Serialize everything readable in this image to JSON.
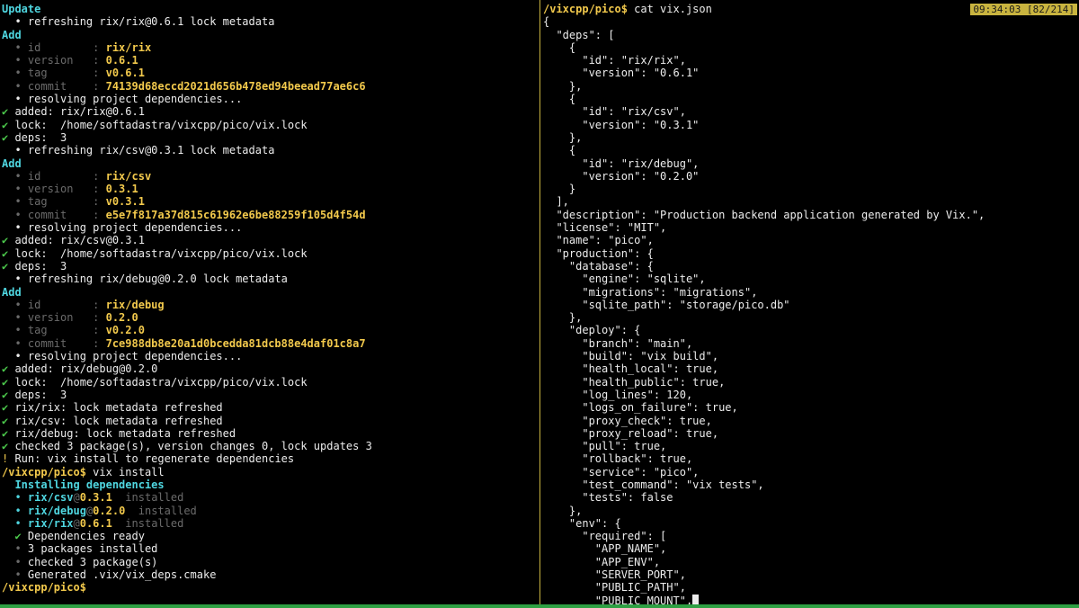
{
  "left": {
    "lines": [
      {
        "segs": [
          {
            "t": "Update",
            "c": "cyan bold"
          }
        ]
      },
      {
        "segs": [
          {
            "t": "  • refreshing rix/rix@0.6.1 lock metadata",
            "c": "white"
          }
        ]
      },
      {
        "segs": [
          {
            "t": "Add",
            "c": "cyan bold"
          }
        ]
      },
      {
        "segs": [
          {
            "t": "  • id        : ",
            "c": "dim"
          },
          {
            "t": "rix/rix",
            "c": "yellow bold"
          }
        ]
      },
      {
        "segs": [
          {
            "t": "  • version   : ",
            "c": "dim"
          },
          {
            "t": "0.6.1",
            "c": "yellow bold"
          }
        ]
      },
      {
        "segs": [
          {
            "t": "  • tag       : ",
            "c": "dim"
          },
          {
            "t": "v0.6.1",
            "c": "yellow bold"
          }
        ]
      },
      {
        "segs": [
          {
            "t": "  • commit    : ",
            "c": "dim"
          },
          {
            "t": "74139d68eccd2021d656b478ed94beead77ae6c6",
            "c": "yellow bold"
          }
        ]
      },
      {
        "segs": [
          {
            "t": "  • resolving project dependencies...",
            "c": "white"
          }
        ]
      },
      {
        "segs": [
          {
            "t": "✔",
            "c": "green"
          },
          {
            "t": " added: rix/rix@0.6.1",
            "c": "white"
          }
        ]
      },
      {
        "segs": [
          {
            "t": "✔",
            "c": "green"
          },
          {
            "t": " lock:  /home/softadastra/vixcpp/pico/vix.lock",
            "c": "white"
          }
        ]
      },
      {
        "segs": [
          {
            "t": "✔",
            "c": "green"
          },
          {
            "t": " deps:  3",
            "c": "white"
          }
        ]
      },
      {
        "segs": [
          {
            "t": "  • refreshing rix/csv@0.3.1 lock metadata",
            "c": "white"
          }
        ]
      },
      {
        "segs": [
          {
            "t": "Add",
            "c": "cyan bold"
          }
        ]
      },
      {
        "segs": [
          {
            "t": "  • id        : ",
            "c": "dim"
          },
          {
            "t": "rix/csv",
            "c": "yellow bold"
          }
        ]
      },
      {
        "segs": [
          {
            "t": "  • version   : ",
            "c": "dim"
          },
          {
            "t": "0.3.1",
            "c": "yellow bold"
          }
        ]
      },
      {
        "segs": [
          {
            "t": "  • tag       : ",
            "c": "dim"
          },
          {
            "t": "v0.3.1",
            "c": "yellow bold"
          }
        ]
      },
      {
        "segs": [
          {
            "t": "  • commit    : ",
            "c": "dim"
          },
          {
            "t": "e5e7f817a37d815c61962e6be88259f105d4f54d",
            "c": "yellow bold"
          }
        ]
      },
      {
        "segs": [
          {
            "t": "  • resolving project dependencies...",
            "c": "white"
          }
        ]
      },
      {
        "segs": [
          {
            "t": "✔",
            "c": "green"
          },
          {
            "t": " added: rix/csv@0.3.1",
            "c": "white"
          }
        ]
      },
      {
        "segs": [
          {
            "t": "✔",
            "c": "green"
          },
          {
            "t": " lock:  /home/softadastra/vixcpp/pico/vix.lock",
            "c": "white"
          }
        ]
      },
      {
        "segs": [
          {
            "t": "✔",
            "c": "green"
          },
          {
            "t": " deps:  3",
            "c": "white"
          }
        ]
      },
      {
        "segs": [
          {
            "t": "  • refreshing rix/debug@0.2.0 lock metadata",
            "c": "white"
          }
        ]
      },
      {
        "segs": [
          {
            "t": "Add",
            "c": "cyan bold"
          }
        ]
      },
      {
        "segs": [
          {
            "t": "  • id        : ",
            "c": "dim"
          },
          {
            "t": "rix/debug",
            "c": "yellow bold"
          }
        ]
      },
      {
        "segs": [
          {
            "t": "  • version   : ",
            "c": "dim"
          },
          {
            "t": "0.2.0",
            "c": "yellow bold"
          }
        ]
      },
      {
        "segs": [
          {
            "t": "  • tag       : ",
            "c": "dim"
          },
          {
            "t": "v0.2.0",
            "c": "yellow bold"
          }
        ]
      },
      {
        "segs": [
          {
            "t": "  • commit    : ",
            "c": "dim"
          },
          {
            "t": "7ce988db8e20a1d0bcedda81dcb88e4daf01c8a7",
            "c": "yellow bold"
          }
        ]
      },
      {
        "segs": [
          {
            "t": "  • resolving project dependencies...",
            "c": "white"
          }
        ]
      },
      {
        "segs": [
          {
            "t": "✔",
            "c": "green"
          },
          {
            "t": " added: rix/debug@0.2.0",
            "c": "white"
          }
        ]
      },
      {
        "segs": [
          {
            "t": "✔",
            "c": "green"
          },
          {
            "t": " lock:  /home/softadastra/vixcpp/pico/vix.lock",
            "c": "white"
          }
        ]
      },
      {
        "segs": [
          {
            "t": "✔",
            "c": "green"
          },
          {
            "t": " deps:  3",
            "c": "white"
          }
        ]
      },
      {
        "segs": [
          {
            "t": "✔",
            "c": "green"
          },
          {
            "t": " rix/rix: lock metadata refreshed",
            "c": "white"
          }
        ]
      },
      {
        "segs": [
          {
            "t": "✔",
            "c": "green"
          },
          {
            "t": " rix/csv: lock metadata refreshed",
            "c": "white"
          }
        ]
      },
      {
        "segs": [
          {
            "t": "✔",
            "c": "green"
          },
          {
            "t": " rix/debug: lock metadata refreshed",
            "c": "white"
          }
        ]
      },
      {
        "segs": [
          {
            "t": "✔",
            "c": "green"
          },
          {
            "t": " checked 3 package(s), version changes 0, lock updates 3",
            "c": "white"
          }
        ]
      },
      {
        "segs": [
          {
            "t": "!",
            "c": "yellow"
          },
          {
            "t": " Run: vix install to regenerate dependencies",
            "c": "white"
          }
        ]
      },
      {
        "segs": [
          {
            "t": "/vixcpp/pico$",
            "c": "prompt-path"
          },
          {
            "t": " vix install",
            "c": "white"
          }
        ]
      },
      {
        "segs": [
          {
            "t": "  Installing dependencies",
            "c": "cyan bold"
          }
        ]
      },
      {
        "segs": [
          {
            "t": "  • ",
            "c": "cyan"
          },
          {
            "t": "rix/csv",
            "c": "cyan bold"
          },
          {
            "t": "@",
            "c": "dim"
          },
          {
            "t": "0.3.1",
            "c": "yellow bold"
          },
          {
            "t": "  installed",
            "c": "dim"
          }
        ]
      },
      {
        "segs": [
          {
            "t": "  • ",
            "c": "cyan"
          },
          {
            "t": "rix/debug",
            "c": "cyan bold"
          },
          {
            "t": "@",
            "c": "dim"
          },
          {
            "t": "0.2.0",
            "c": "yellow bold"
          },
          {
            "t": "  installed",
            "c": "dim"
          }
        ]
      },
      {
        "segs": [
          {
            "t": "  • ",
            "c": "cyan"
          },
          {
            "t": "rix/rix",
            "c": "cyan bold"
          },
          {
            "t": "@",
            "c": "dim"
          },
          {
            "t": "0.6.1",
            "c": "yellow bold"
          },
          {
            "t": "  installed",
            "c": "dim"
          }
        ]
      },
      {
        "segs": [
          {
            "t": "  ✔",
            "c": "green"
          },
          {
            "t": " Dependencies ready",
            "c": "white"
          }
        ]
      },
      {
        "segs": [
          {
            "t": "  •",
            "c": "dim"
          },
          {
            "t": " 3 packages installed",
            "c": "white"
          }
        ]
      },
      {
        "segs": [
          {
            "t": "  •",
            "c": "dim"
          },
          {
            "t": " checked 3 package(s)",
            "c": "white"
          }
        ]
      },
      {
        "segs": [
          {
            "t": "  •",
            "c": "dim"
          },
          {
            "t": " Generated .vix/vix_deps.cmake",
            "c": "white"
          }
        ]
      },
      {
        "segs": [
          {
            "t": "/vixcpp/pico$",
            "c": "prompt-path"
          }
        ]
      }
    ]
  },
  "right": {
    "clock": "09:34:03 [82/214]",
    "lines": [
      {
        "segs": [
          {
            "t": "/vixcpp/pico$",
            "c": "prompt-path"
          },
          {
            "t": " cat vix.json",
            "c": "white"
          }
        ]
      },
      {
        "segs": [
          {
            "t": "{",
            "c": "white"
          }
        ]
      },
      {
        "segs": [
          {
            "t": "  \"deps\": [",
            "c": "white"
          }
        ]
      },
      {
        "segs": [
          {
            "t": "    {",
            "c": "white"
          }
        ]
      },
      {
        "segs": [
          {
            "t": "      \"id\": \"rix/rix\",",
            "c": "white"
          }
        ]
      },
      {
        "segs": [
          {
            "t": "      \"version\": \"0.6.1\"",
            "c": "white"
          }
        ]
      },
      {
        "segs": [
          {
            "t": "    },",
            "c": "white"
          }
        ]
      },
      {
        "segs": [
          {
            "t": "    {",
            "c": "white"
          }
        ]
      },
      {
        "segs": [
          {
            "t": "      \"id\": \"rix/csv\",",
            "c": "white"
          }
        ]
      },
      {
        "segs": [
          {
            "t": "      \"version\": \"0.3.1\"",
            "c": "white"
          }
        ]
      },
      {
        "segs": [
          {
            "t": "    },",
            "c": "white"
          }
        ]
      },
      {
        "segs": [
          {
            "t": "    {",
            "c": "white"
          }
        ]
      },
      {
        "segs": [
          {
            "t": "      \"id\": \"rix/debug\",",
            "c": "white"
          }
        ]
      },
      {
        "segs": [
          {
            "t": "      \"version\": \"0.2.0\"",
            "c": "white"
          }
        ]
      },
      {
        "segs": [
          {
            "t": "    }",
            "c": "white"
          }
        ]
      },
      {
        "segs": [
          {
            "t": "  ],",
            "c": "white"
          }
        ]
      },
      {
        "segs": [
          {
            "t": "  \"description\": \"Production backend application generated by Vix.\",",
            "c": "white"
          }
        ]
      },
      {
        "segs": [
          {
            "t": "  \"license\": \"MIT\",",
            "c": "white"
          }
        ]
      },
      {
        "segs": [
          {
            "t": "  \"name\": \"pico\",",
            "c": "white"
          }
        ]
      },
      {
        "segs": [
          {
            "t": "  \"production\": {",
            "c": "white"
          }
        ]
      },
      {
        "segs": [
          {
            "t": "    \"database\": {",
            "c": "white"
          }
        ]
      },
      {
        "segs": [
          {
            "t": "      \"engine\": \"sqlite\",",
            "c": "white"
          }
        ]
      },
      {
        "segs": [
          {
            "t": "      \"migrations\": \"migrations\",",
            "c": "white"
          }
        ]
      },
      {
        "segs": [
          {
            "t": "      \"sqlite_path\": \"storage/pico.db\"",
            "c": "white"
          }
        ]
      },
      {
        "segs": [
          {
            "t": "    },",
            "c": "white"
          }
        ]
      },
      {
        "segs": [
          {
            "t": "    \"deploy\": {",
            "c": "white"
          }
        ]
      },
      {
        "segs": [
          {
            "t": "      \"branch\": \"main\",",
            "c": "white"
          }
        ]
      },
      {
        "segs": [
          {
            "t": "      \"build\": \"vix build\",",
            "c": "white"
          }
        ]
      },
      {
        "segs": [
          {
            "t": "      \"health_local\": true,",
            "c": "white"
          }
        ]
      },
      {
        "segs": [
          {
            "t": "      \"health_public\": true,",
            "c": "white"
          }
        ]
      },
      {
        "segs": [
          {
            "t": "      \"log_lines\": 120,",
            "c": "white"
          }
        ]
      },
      {
        "segs": [
          {
            "t": "      \"logs_on_failure\": true,",
            "c": "white"
          }
        ]
      },
      {
        "segs": [
          {
            "t": "      \"proxy_check\": true,",
            "c": "white"
          }
        ]
      },
      {
        "segs": [
          {
            "t": "      \"proxy_reload\": true,",
            "c": "white"
          }
        ]
      },
      {
        "segs": [
          {
            "t": "      \"pull\": true,",
            "c": "white"
          }
        ]
      },
      {
        "segs": [
          {
            "t": "      \"rollback\": true,",
            "c": "white"
          }
        ]
      },
      {
        "segs": [
          {
            "t": "      \"service\": \"pico\",",
            "c": "white"
          }
        ]
      },
      {
        "segs": [
          {
            "t": "      \"test_command\": \"vix tests\",",
            "c": "white"
          }
        ]
      },
      {
        "segs": [
          {
            "t": "      \"tests\": false",
            "c": "white"
          }
        ]
      },
      {
        "segs": [
          {
            "t": "    },",
            "c": "white"
          }
        ]
      },
      {
        "segs": [
          {
            "t": "    \"env\": {",
            "c": "white"
          }
        ]
      },
      {
        "segs": [
          {
            "t": "      \"required\": [",
            "c": "white"
          }
        ]
      },
      {
        "segs": [
          {
            "t": "        \"APP_NAME\",",
            "c": "white"
          }
        ]
      },
      {
        "segs": [
          {
            "t": "        \"APP_ENV\",",
            "c": "white"
          }
        ]
      },
      {
        "segs": [
          {
            "t": "        \"SERVER_PORT\",",
            "c": "white"
          }
        ]
      },
      {
        "segs": [
          {
            "t": "        \"PUBLIC_PATH\",",
            "c": "white"
          }
        ]
      },
      {
        "segs": [
          {
            "t": "        \"PUBLIC_MOUNT\",",
            "c": "white"
          }
        ]
      }
    ]
  }
}
